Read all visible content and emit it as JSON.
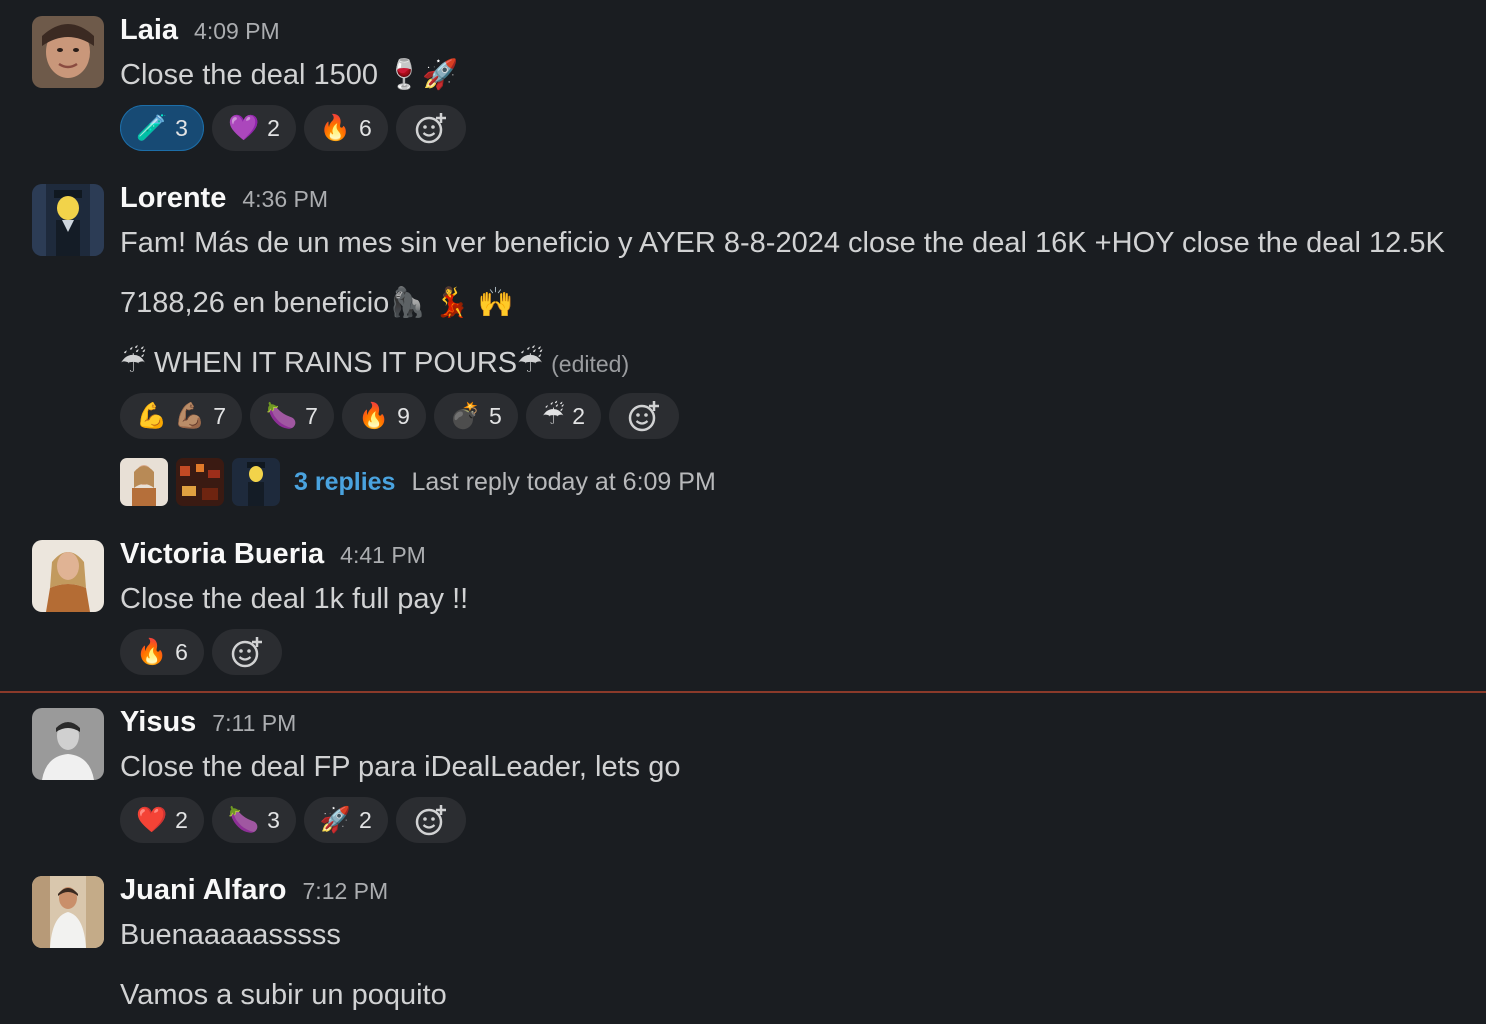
{
  "messages": [
    {
      "author": "Laia",
      "time": "4:09 PM",
      "lines": [
        "Close the deal 1500 🍷🚀"
      ],
      "reactions": [
        {
          "icon": "🧪",
          "count": "3",
          "active": true
        },
        {
          "icon": "💜",
          "count": "2"
        },
        {
          "icon": "🔥",
          "count": "6"
        }
      ]
    },
    {
      "author": "Lorente",
      "time": "4:36 PM",
      "lines": [
        "Fam! Más de un mes sin ver beneficio y AYER 8-8-2024 close the deal 16K +HOY close the deal 12.5K",
        "7188,26 en beneficio🦍 💃 🙌",
        "☔ WHEN IT RAINS IT POURS☔"
      ],
      "edited": "(edited)",
      "reactions": [
        {
          "icon": "💪 💪🏽",
          "count": "7"
        },
        {
          "icon": "🍆",
          "count": "7"
        },
        {
          "icon": "🔥",
          "count": "9"
        },
        {
          "icon": "💣",
          "count": "5"
        },
        {
          "icon": "☔",
          "count": "2"
        }
      ],
      "thread": {
        "replies": "3 replies",
        "last_reply": "Last reply today at 6:09 PM"
      }
    },
    {
      "author": "Victoria Bueria",
      "time": "4:41 PM",
      "lines": [
        "Close the deal 1k full pay !!"
      ],
      "reactions": [
        {
          "icon": "🔥",
          "count": "6"
        }
      ]
    },
    {
      "author": "Yisus",
      "time": "7:11 PM",
      "lines": [
        "Close the deal FP para iDealLeader, lets go"
      ],
      "reactions": [
        {
          "icon": "❤️",
          "count": "2"
        },
        {
          "icon": "🍆",
          "count": "3"
        },
        {
          "icon": "🚀",
          "count": "2"
        }
      ]
    },
    {
      "author": "Juani Alfaro",
      "time": "7:12 PM",
      "lines": [
        "Buenaaaaasssss",
        "Vamos a subir un poquito"
      ]
    }
  ],
  "colors": {
    "background": "#1a1d21",
    "pill": "#2b2d31",
    "pill_active": "#174a74",
    "link": "#4aa3df",
    "new_divider": "#8b3a2a"
  },
  "icons": {
    "add_reaction": "add-reaction-icon"
  }
}
